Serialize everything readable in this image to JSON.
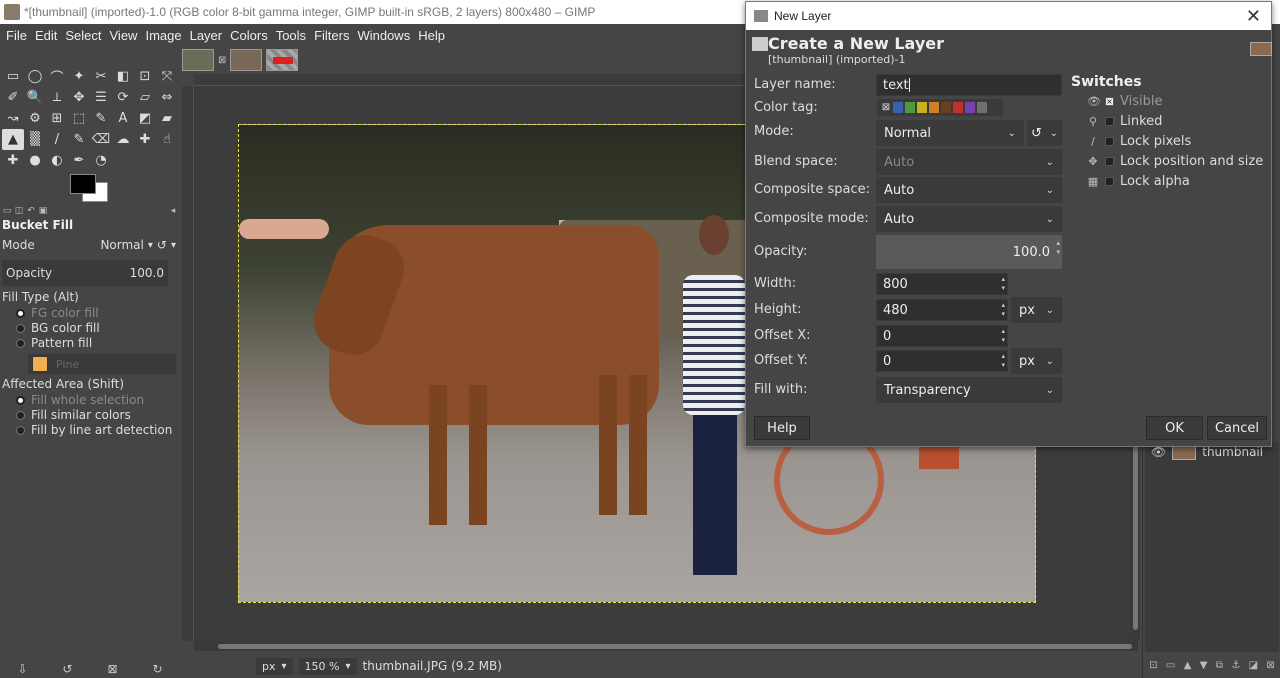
{
  "window": {
    "title": "*[thumbnail] (imported)-1.0 (RGB color 8-bit gamma integer, GIMP built-in sRGB, 2 layers) 800x480 – GIMP"
  },
  "menubar": [
    "File",
    "Edit",
    "Select",
    "View",
    "Image",
    "Layer",
    "Colors",
    "Tools",
    "Filters",
    "Windows",
    "Help"
  ],
  "toolbox": {
    "tool_icons": [
      "rect-select-icon",
      "ellipse-select-icon",
      "free-select-icon",
      "fuzzy-select-icon",
      "scissors-icon",
      "foreground-select-icon",
      "crop-icon",
      "transform-icon",
      "color-picker-icon",
      "zoom-icon",
      "measure-icon",
      "move-icon",
      "align-icon",
      "rotate-icon",
      "perspective-icon",
      "flip-icon",
      "warp-icon",
      "handle-transform-icon",
      "cage-icon",
      "unified-transform-icon",
      "paths-icon",
      "text-icon",
      "free-select-2-icon",
      "shear-icon",
      "bucket-fill-icon",
      "gradient-icon",
      "pencil-icon",
      "paintbrush-icon",
      "eraser-icon",
      "airbrush-icon",
      "clone-icon",
      "smudge-icon",
      "heal-icon",
      "blur-icon",
      "dodge-icon",
      "ink-icon",
      "mypaint-icon"
    ],
    "tool_glyphs": [
      "▭",
      "◯",
      "⌒",
      "✦",
      "✂",
      "◧",
      "⊡",
      "⤧",
      "✐",
      "🔍",
      "⟂",
      "✥",
      "☰",
      "⟳",
      "▱",
      "⇔",
      "↝",
      "⚙",
      "⊞",
      "⬚",
      "✎",
      "A",
      "◩",
      "▰",
      "▲",
      "▒",
      "/",
      "✎",
      "⌫",
      "☁",
      "✚",
      "☝",
      "✚",
      "●",
      "◐",
      "✒",
      "◔"
    ],
    "active_tool_index": 24,
    "fg_color": "#000000",
    "bg_color": "#ffffff"
  },
  "tool_options": {
    "title": "Bucket Fill",
    "mode_label": "Mode",
    "mode_value": "Normal",
    "opacity_label": "Opacity",
    "opacity_value": "100.0",
    "fill_type_label": "Fill Type  (Alt)",
    "fill_types": [
      "FG color fill",
      "BG color fill",
      "Pattern fill"
    ],
    "fill_type_selected": 0,
    "pattern_color": "#f0b050",
    "pattern_name": "Pine",
    "affected_area_label": "Affected Area  (Shift)",
    "affected_areas": [
      "Fill whole selection",
      "Fill similar colors",
      "Fill by line art detection"
    ],
    "affected_area_selected": 0
  },
  "statusbar": {
    "unit": "px",
    "zoom": "150 %",
    "file_info": "thumbnail.JPG (9.2 MB)"
  },
  "layers_panel": {
    "layer_name": "thumbnail"
  },
  "dialog": {
    "window_title": "New Layer",
    "heading": "Create a New Layer",
    "subheading": "[thumbnail] (imported)-1",
    "layer_name_label": "Layer name:",
    "layer_name_value": "text",
    "color_tag_label": "Color tag:",
    "color_tags": [
      "#3a60b0",
      "#4f9a3a",
      "#c8b020",
      "#d08020",
      "#6a4020",
      "#c03030",
      "#7a40b0",
      "#707070"
    ],
    "mode_label": "Mode:",
    "mode_value": "Normal",
    "blend_space_label": "Blend space:",
    "blend_space_value": "Auto",
    "composite_space_label": "Composite space:",
    "composite_space_value": "Auto",
    "composite_mode_label": "Composite mode:",
    "composite_mode_value": "Auto",
    "opacity_label": "Opacity:",
    "opacity_value": "100.0",
    "width_label": "Width:",
    "width_value": "800",
    "height_label": "Height:",
    "height_value": "480",
    "size_unit": "px",
    "offset_x_label": "Offset X:",
    "offset_x_value": "0",
    "offset_y_label": "Offset Y:",
    "offset_y_value": "0",
    "offset_unit": "px",
    "fill_with_label": "Fill with:",
    "fill_with_value": "Transparency",
    "switches_title": "Switches",
    "switches": [
      {
        "label": "Visible",
        "checked": true,
        "icon": "eye-icon",
        "glyph": "👁",
        "dimmed": true
      },
      {
        "label": "Linked",
        "checked": false,
        "icon": "chain-icon",
        "glyph": "⚲",
        "dimmed": false
      },
      {
        "label": "Lock pixels",
        "checked": false,
        "icon": "brush-icon",
        "glyph": "/",
        "dimmed": false
      },
      {
        "label": "Lock position and size",
        "checked": false,
        "icon": "move-icon",
        "glyph": "✥",
        "dimmed": false
      },
      {
        "label": "Lock alpha",
        "checked": false,
        "icon": "checker-icon",
        "glyph": "▦",
        "dimmed": false
      }
    ],
    "help_button": "Help",
    "ok_button": "OK",
    "cancel_button": "Cancel"
  }
}
